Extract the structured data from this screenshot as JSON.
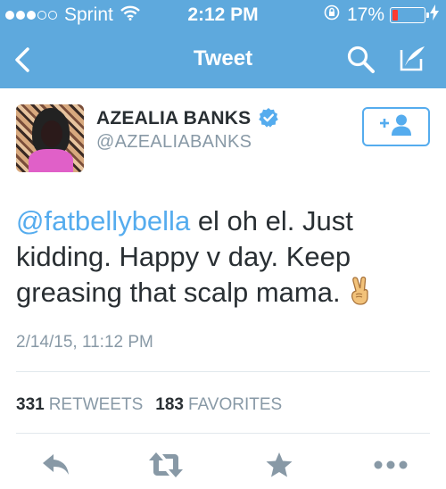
{
  "status_bar": {
    "carrier": "Sprint",
    "time": "2:12 PM",
    "battery_percent": "17%",
    "battery_level": 0.17
  },
  "nav": {
    "title": "Tweet"
  },
  "tweet": {
    "display_name": "AZEALIA BANKS",
    "handle": "@AZEALIABANKS",
    "mention": "@fatbellybella",
    "text": " el oh el. Just kidding. Happy v day. Keep greasing that scalp mama.",
    "emoji": "victory-hand",
    "timestamp": "2/14/15, 11:12 PM",
    "retweets_count": "331",
    "retweets_label": "RETWEETS",
    "favorites_count": "183",
    "favorites_label": "FAVORITES"
  },
  "colors": {
    "nav_background": "#5ea9dd",
    "accent": "#55acee",
    "text": "#292f33",
    "muted": "#8899a6",
    "battery_low": "#ff3b30"
  },
  "icons": [
    "back-icon",
    "search-icon",
    "compose-icon",
    "verified-icon",
    "follow-icon",
    "reply-icon",
    "retweet-icon",
    "favorite-icon",
    "more-icon"
  ]
}
